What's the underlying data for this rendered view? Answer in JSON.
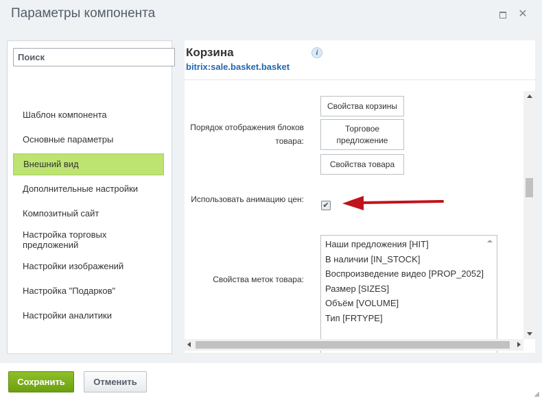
{
  "window": {
    "title": "Параметры компонента"
  },
  "sidebar": {
    "search_placeholder": "Поиск",
    "items": [
      {
        "label": "Шаблон компонента"
      },
      {
        "label": "Основные параметры"
      },
      {
        "label": "Внешний вид",
        "active": true
      },
      {
        "label": "Дополнительные настройки"
      },
      {
        "label": "Композитный сайт"
      },
      {
        "label": "Настройка торговых предложений"
      },
      {
        "label": "Настройки изображений"
      },
      {
        "label": "Настройка \"Подарков\""
      },
      {
        "label": "Настройки аналитики"
      }
    ]
  },
  "component": {
    "title": "Корзина",
    "code": "bitrix:sale.basket.basket",
    "info_icon": "info-icon"
  },
  "settings": {
    "order_label": "Порядок отображения блоков товара:",
    "order_buttons": [
      "Свойства корзины",
      "Торговое предложение",
      "Свойства товара"
    ],
    "animation_label": "Использовать анимацию цен:",
    "animation_checked": true,
    "labels_label": "Свойства меток товара:",
    "labels_options": [
      "Наши предложения [HIT]",
      "В наличии [IN_STOCK]",
      "Воспроизведение видео [PROP_2052]",
      "Размер [SIZES]",
      "Объём [VOLUME]",
      "Тип [FRTYPE]"
    ]
  },
  "footer": {
    "save": "Сохранить",
    "cancel": "Отменить"
  },
  "colors": {
    "active_item": "#bde371",
    "save_button": "#7aae19",
    "annotation_arrow": "#c0131b",
    "link": "#2067b0"
  }
}
